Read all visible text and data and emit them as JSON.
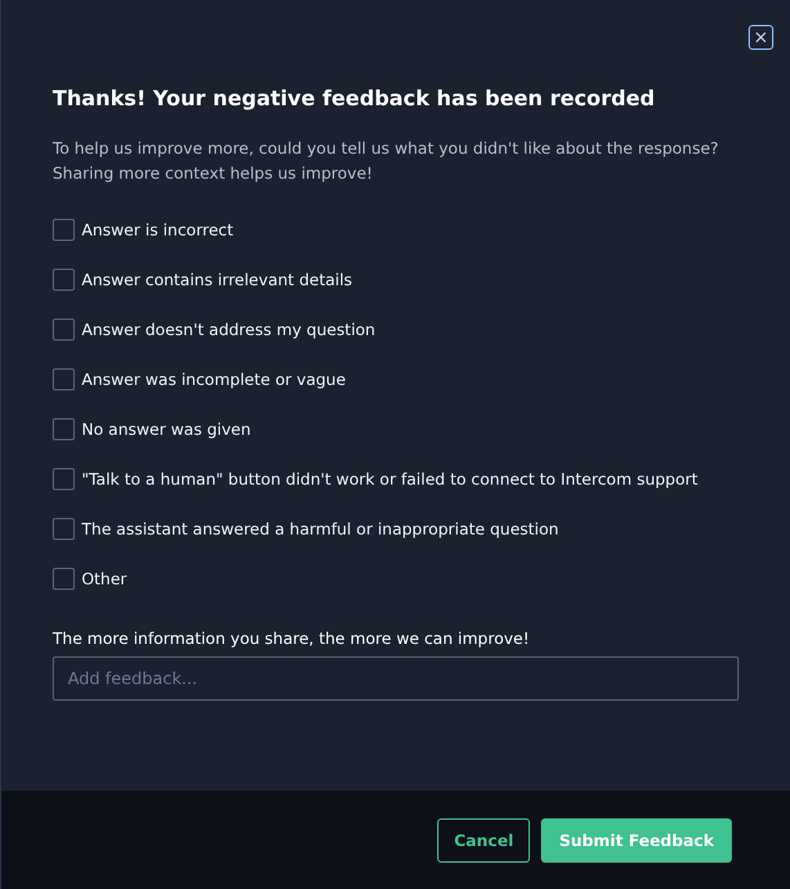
{
  "dialog": {
    "close_label": "×",
    "title": "Thanks! Your negative feedback has been recorded",
    "description": [
      "To help us improve more, could you tell us what you didn't like about the response?",
      "Sharing more context helps us improve!"
    ],
    "reasons": [
      {
        "label": "Answer is incorrect",
        "checked": false
      },
      {
        "label": "Answer contains irrelevant details",
        "checked": false
      },
      {
        "label": "Answer doesn't address my question",
        "checked": false
      },
      {
        "label": "Answer was incomplete or vague",
        "checked": false
      },
      {
        "label": "No answer was given",
        "checked": false
      },
      {
        "label": "\"Talk to a human\" button didn't work or failed to connect to Intercom support",
        "checked": false
      },
      {
        "label": "The assistant answered a harmful or inappropriate question",
        "checked": false
      },
      {
        "label": "Other",
        "checked": false
      }
    ],
    "feedback": {
      "label": "The more information you share, the more we can improve!",
      "placeholder": "Add feedback..."
    },
    "buttons": [
      {
        "label": "Cancel",
        "kind": "secondary"
      },
      {
        "label": "Submit Feedback",
        "kind": "primary"
      }
    ]
  }
}
